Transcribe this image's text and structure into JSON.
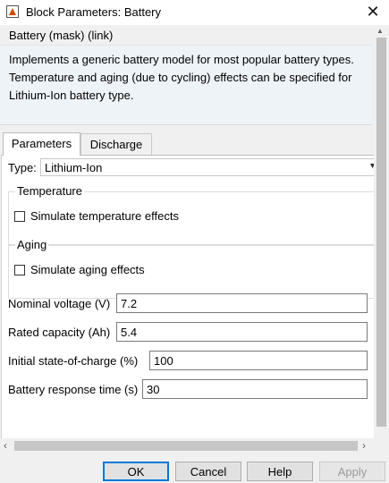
{
  "window": {
    "title": "Block Parameters: Battery",
    "close_glyph": "✕"
  },
  "block": {
    "header": "Battery (mask) (link)",
    "description": "Implements a generic battery model for most popular battery types. Temperature and aging (due to cycling) effects can be specified for Lithium-Ion battery type."
  },
  "tabs": [
    {
      "label": "Parameters",
      "active": true
    },
    {
      "label": "Discharge",
      "active": false
    }
  ],
  "type": {
    "label": "Type:",
    "value": "Lithium-Ion"
  },
  "temperature": {
    "group_label": "Temperature",
    "checkbox_label": "Simulate temperature effects",
    "checked": false
  },
  "aging": {
    "group_label": "Aging",
    "checkbox_label": "Simulate aging effects",
    "checked": false
  },
  "params": [
    {
      "label": "Nominal voltage (V)",
      "value": "7.2"
    },
    {
      "label": "Rated capacity (Ah)",
      "value": "5.4"
    },
    {
      "label": "Initial state-of-charge (%)",
      "value": "100"
    },
    {
      "label": "Battery response time (s)",
      "value": "30"
    }
  ],
  "buttons": {
    "ok": "OK",
    "cancel": "Cancel",
    "help": "Help",
    "apply": "Apply",
    "apply_enabled": false
  },
  "icons": {
    "menu": "⋮",
    "dropdown": "▼",
    "scroll_up": "▲",
    "scroll_down": "▼",
    "scroll_left": "‹",
    "scroll_right": "›"
  },
  "colors": {
    "ok_border": "#0078d7",
    "description_bg": "#eef3f8"
  }
}
